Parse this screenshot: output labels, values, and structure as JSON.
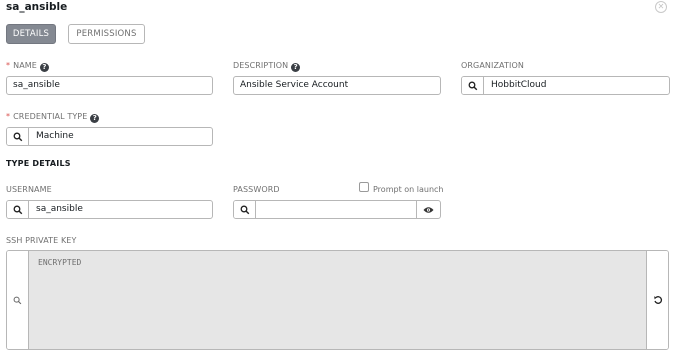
{
  "header": {
    "title": "sa_ansible",
    "close_icon": "close-circle-icon"
  },
  "tabs": [
    {
      "label": "DETAILS",
      "active": true
    },
    {
      "label": "PERMISSIONS",
      "active": false
    }
  ],
  "fields": {
    "name": {
      "label": "NAME",
      "required": true,
      "help": "?",
      "value": "sa_ansible"
    },
    "description": {
      "label": "DESCRIPTION",
      "required": false,
      "help": "?",
      "value": "Ansible Service Account"
    },
    "organization": {
      "label": "ORGANIZATION",
      "value": "HobbitCloud",
      "icon": "search-icon"
    },
    "credential_type": {
      "label": "CREDENTIAL TYPE",
      "required": true,
      "help": "?",
      "value": "Machine",
      "icon": "search-icon"
    }
  },
  "type_details": {
    "heading": "TYPE DETAILS",
    "username": {
      "label": "USERNAME",
      "value": "sa_ansible",
      "icon": "search-icon"
    },
    "password": {
      "label": "PASSWORD",
      "value": "",
      "prompt_label": "Prompt on launch",
      "prompt_checked": false,
      "icon": "search-icon",
      "reveal_icon": "eye-icon"
    },
    "ssh_private_key": {
      "label": "SSH PRIVATE KEY",
      "value": "ENCRYPTED",
      "icon": "search-icon",
      "replace_icon": "undo-icon"
    }
  },
  "colors": {
    "required_marker": "#d9534f",
    "active_tab_bg": "#848992",
    "encrypted_bg": "#e6e6e6"
  }
}
